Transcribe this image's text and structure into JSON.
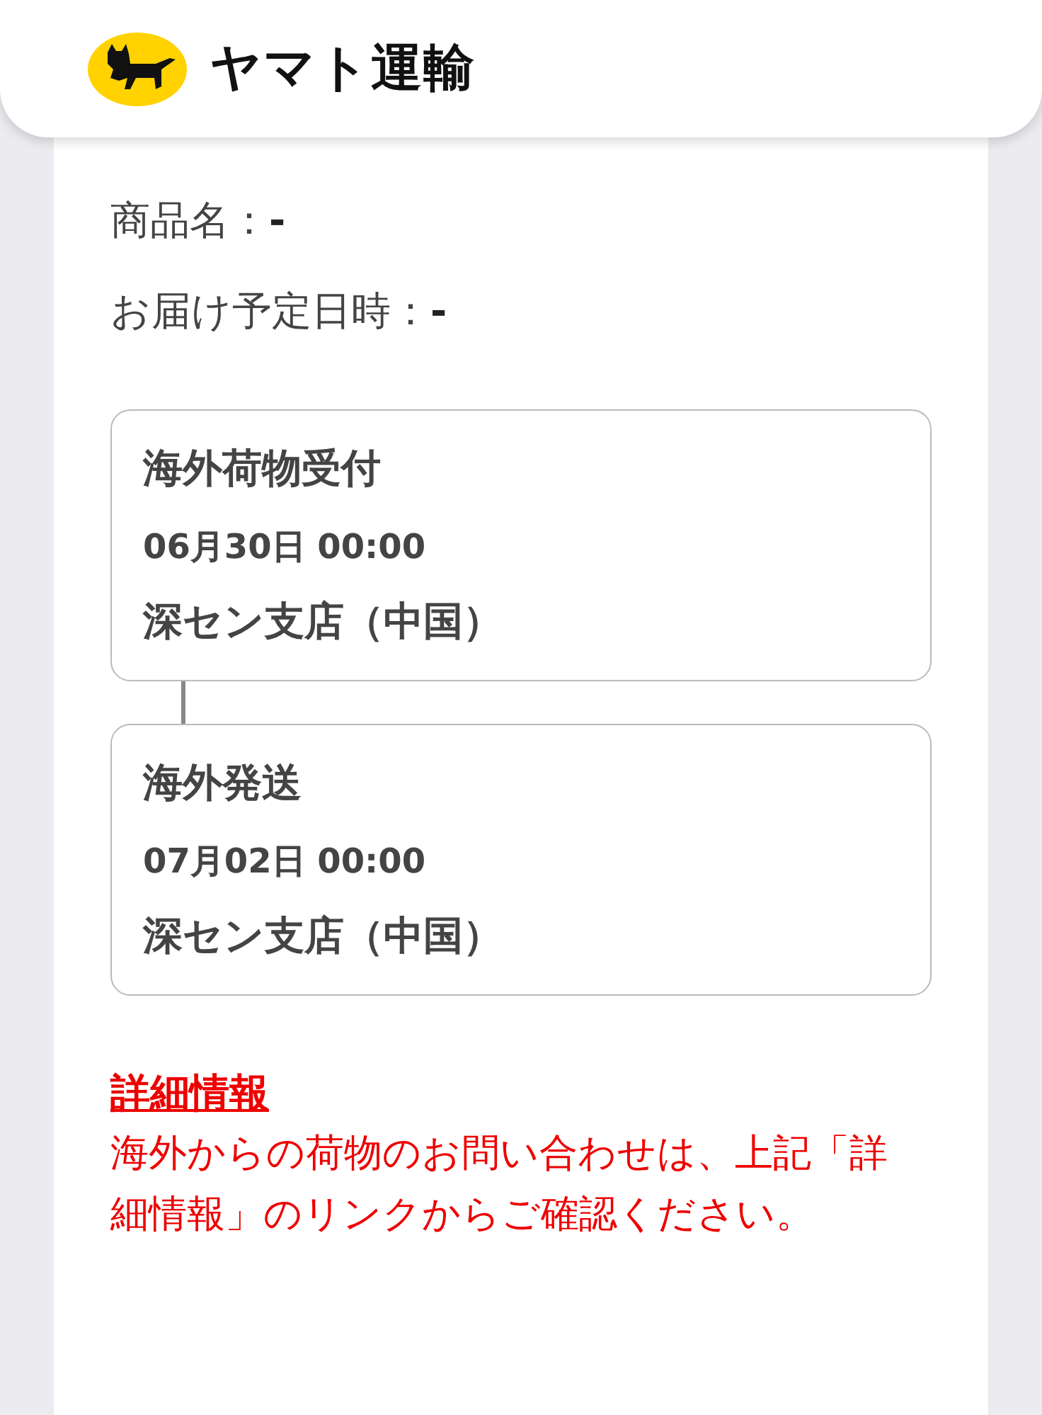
{
  "header": {
    "logo_text": "ヤマト運輸"
  },
  "summary": [
    "商品名：**-**",
    "お届け予定日時：**-**"
  ],
  "events": [
    {
      "status": "海外荷物受付",
      "datetime": "06月30日 00:00",
      "location": "深セン支店（中国）"
    },
    {
      "status": "海外発送",
      "datetime": "07月02日 00:00",
      "location": "深セン支店（中国）"
    }
  ],
  "details": {
    "link": "詳細情報",
    "note": "海外からの荷物のお問い合わせは、上記「詳細情報」のリンクからご確認ください。"
  }
}
